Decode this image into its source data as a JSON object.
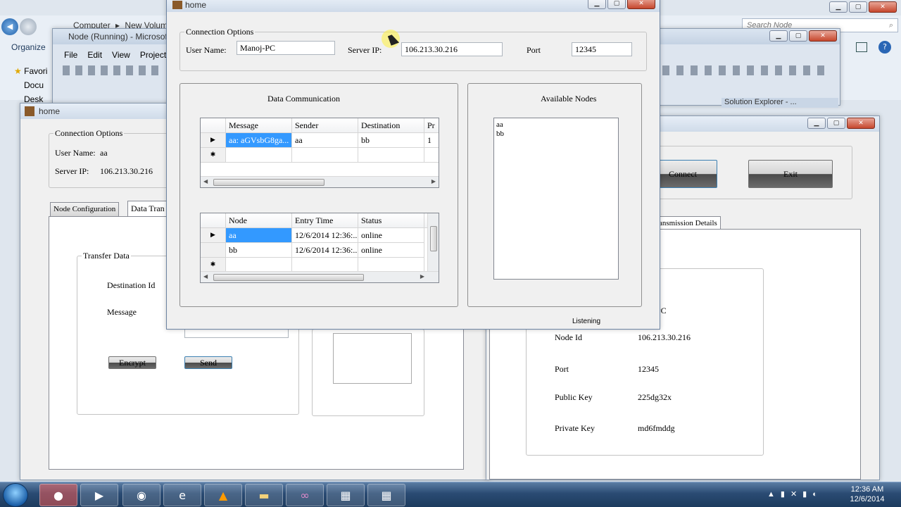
{
  "bg_explorer": {
    "back_glyph": "◀",
    "breadcrumb": [
      "Computer",
      "New Volum"
    ],
    "search_placeholder": "Search Node",
    "organize_label": "Organize",
    "favorites_label": "Favori",
    "docs_label": "Docu",
    "desk_label": "Desk"
  },
  "vs_window": {
    "title": "Node (Running) - Microsoft",
    "menu": [
      "File",
      "Edit",
      "View",
      "Project"
    ],
    "solution_explorer_title": "Solution Explorer - ..."
  },
  "left_home": {
    "title": "home",
    "connection_options": "Connection Options",
    "user_name_label": "User Name:",
    "user_name_value": "aa",
    "server_ip_label": "Server IP:",
    "server_ip_value": "106.213.30.216",
    "tabs": [
      "Node Configuration",
      "Data Tran"
    ],
    "transfer_data": "Transfer Data",
    "destination_id_label": "Destination Id",
    "message_label": "Message",
    "encrypt_label": "Encrypt",
    "send_label": "Send"
  },
  "right_home": {
    "connect_label": "Connect",
    "exit_label": "Exit",
    "tab_transmission": "ansmission Details",
    "name_tail": "PC",
    "node_id_label": "Node Id",
    "node_id_value": "106.213.30.216",
    "port_label": "Port",
    "port_value": "12345",
    "public_key_label": "Public Key",
    "public_key_value": "225dg32x",
    "private_key_label": "Private Key",
    "private_key_value": "md6fmddg"
  },
  "main_home": {
    "title": "home",
    "connection_options": "Connection Options",
    "user_name_label": "User Name:",
    "user_name_value": "Manoj-PC",
    "server_ip_label": "Server IP:",
    "server_ip_value": "106.213.30.216",
    "port_label": "Port",
    "port_value": "12345",
    "data_comm_title": "Data Communication",
    "messages_grid": {
      "columns": [
        "Message",
        "Sender",
        "Destination",
        "Pr"
      ],
      "rows": [
        [
          "aa: aGVsbG8ga...",
          "aa",
          "bb",
          "1"
        ]
      ]
    },
    "nodes_grid": {
      "columns": [
        "Node",
        "Entry Time",
        "Status"
      ],
      "rows": [
        [
          "aa",
          "12/6/2014 12:36:...",
          "online"
        ],
        [
          "bb",
          "12/6/2014 12:36:...",
          "online"
        ]
      ]
    },
    "available_nodes_title": "Available Nodes",
    "available_nodes": [
      "aa",
      "bb"
    ],
    "status_text": "Listening"
  },
  "taskbar": {
    "time": "12:36 AM",
    "date": "12/6/2014"
  }
}
